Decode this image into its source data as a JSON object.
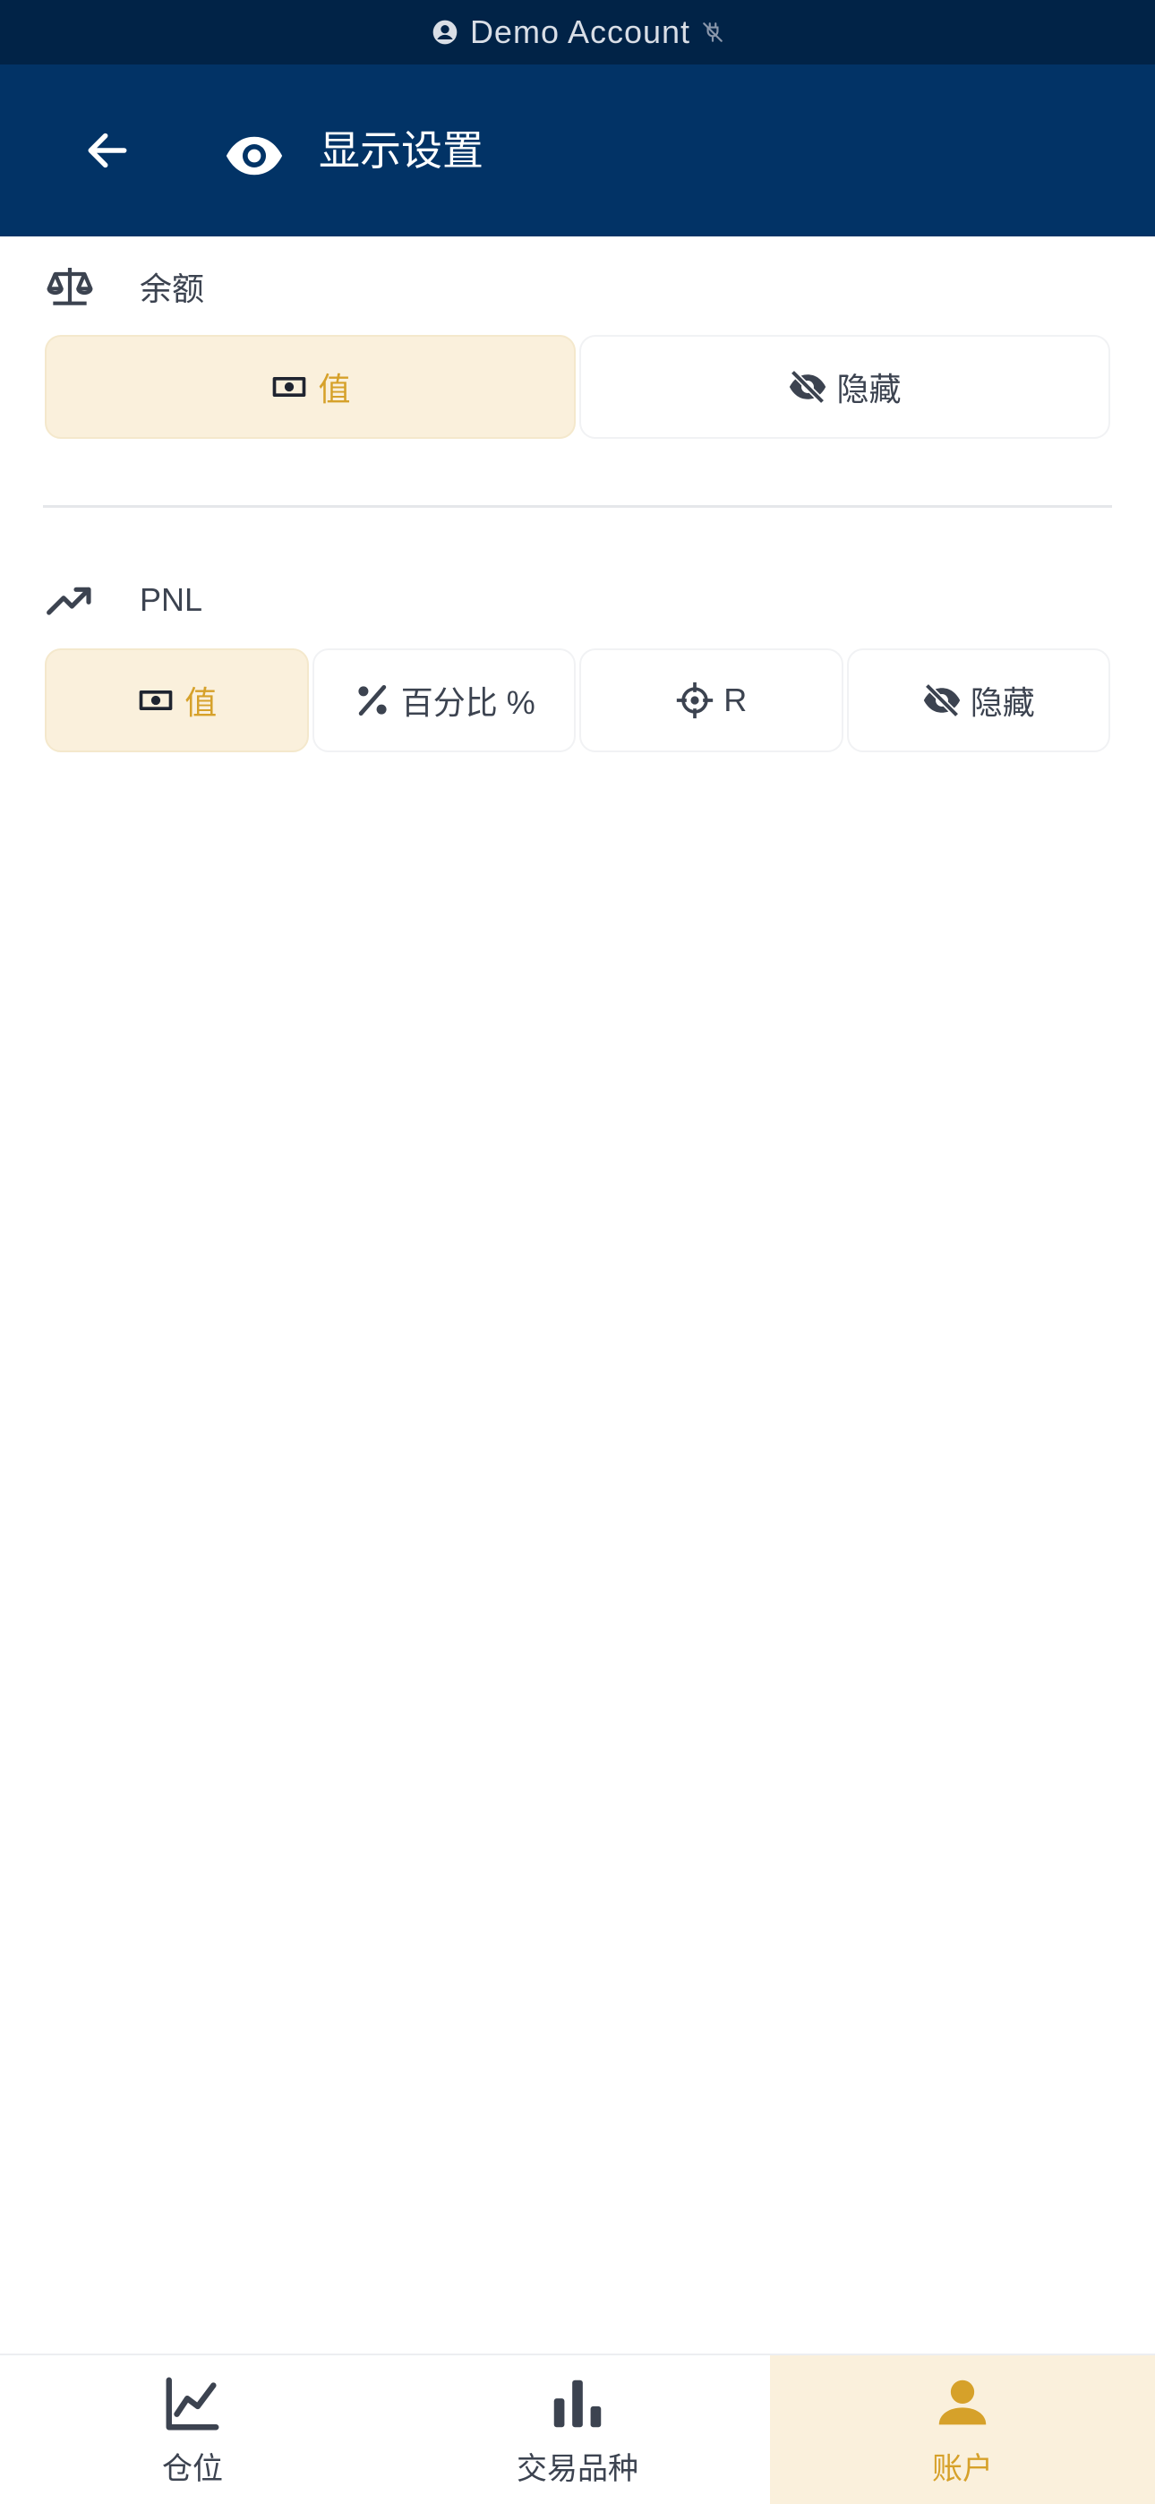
{
  "demo_bar": {
    "label": "Demo Account",
    "user_icon": "account-circle-icon",
    "status_icon": "plug-off-icon"
  },
  "header": {
    "back_icon": "arrow-left-icon",
    "title_icon": "eye-icon",
    "title": "显示设置"
  },
  "balance": {
    "icon": "scale-balance-icon",
    "label": "余额",
    "options": [
      {
        "label": "值",
        "icon": "cash-icon",
        "active": true
      },
      {
        "label": "隐藏",
        "icon": "eye-off-icon",
        "active": false
      }
    ]
  },
  "pnl": {
    "icon": "trending-up-icon",
    "label": "PNL",
    "options": [
      {
        "label": "值",
        "icon": "cash-icon",
        "active": true
      },
      {
        "label": "百分比 %",
        "icon": "percent-icon",
        "active": false
      },
      {
        "label": "R",
        "icon": "crosshair-icon",
        "active": false
      },
      {
        "label": "隐藏",
        "icon": "eye-off-icon",
        "active": false
      }
    ]
  },
  "nav": {
    "items": [
      {
        "label": "仓位",
        "icon": "chart-line-icon",
        "active": false
      },
      {
        "label": "交易品种",
        "icon": "bar-chart-icon",
        "active": false
      },
      {
        "label": "账户",
        "icon": "person-icon",
        "active": true
      }
    ]
  },
  "colors": {
    "primary": "#023366",
    "demo_bar": "#012347",
    "accent": "#d6a12a",
    "accent_bg": "#faf0dc",
    "text": "#3c4350"
  }
}
